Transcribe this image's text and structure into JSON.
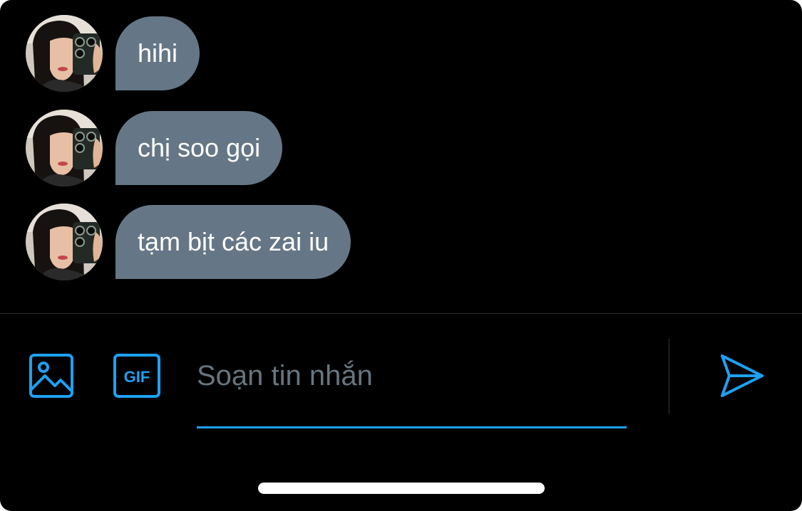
{
  "messages": [
    {
      "text": "hihi"
    },
    {
      "text": "chị soo gọi"
    },
    {
      "text": "tạm bịt các zai iu"
    }
  ],
  "composer": {
    "placeholder": "Soạn tin nhắn",
    "image_icon": "image-icon",
    "gif_icon": "gif-icon",
    "gif_label": "GIF",
    "send_icon": "send-icon"
  },
  "colors": {
    "background": "#000000",
    "bubble": "#657786",
    "bubble_text": "#ffffff",
    "accent": "#1da1f2",
    "placeholder": "#66757f",
    "divider": "#2f3336"
  }
}
